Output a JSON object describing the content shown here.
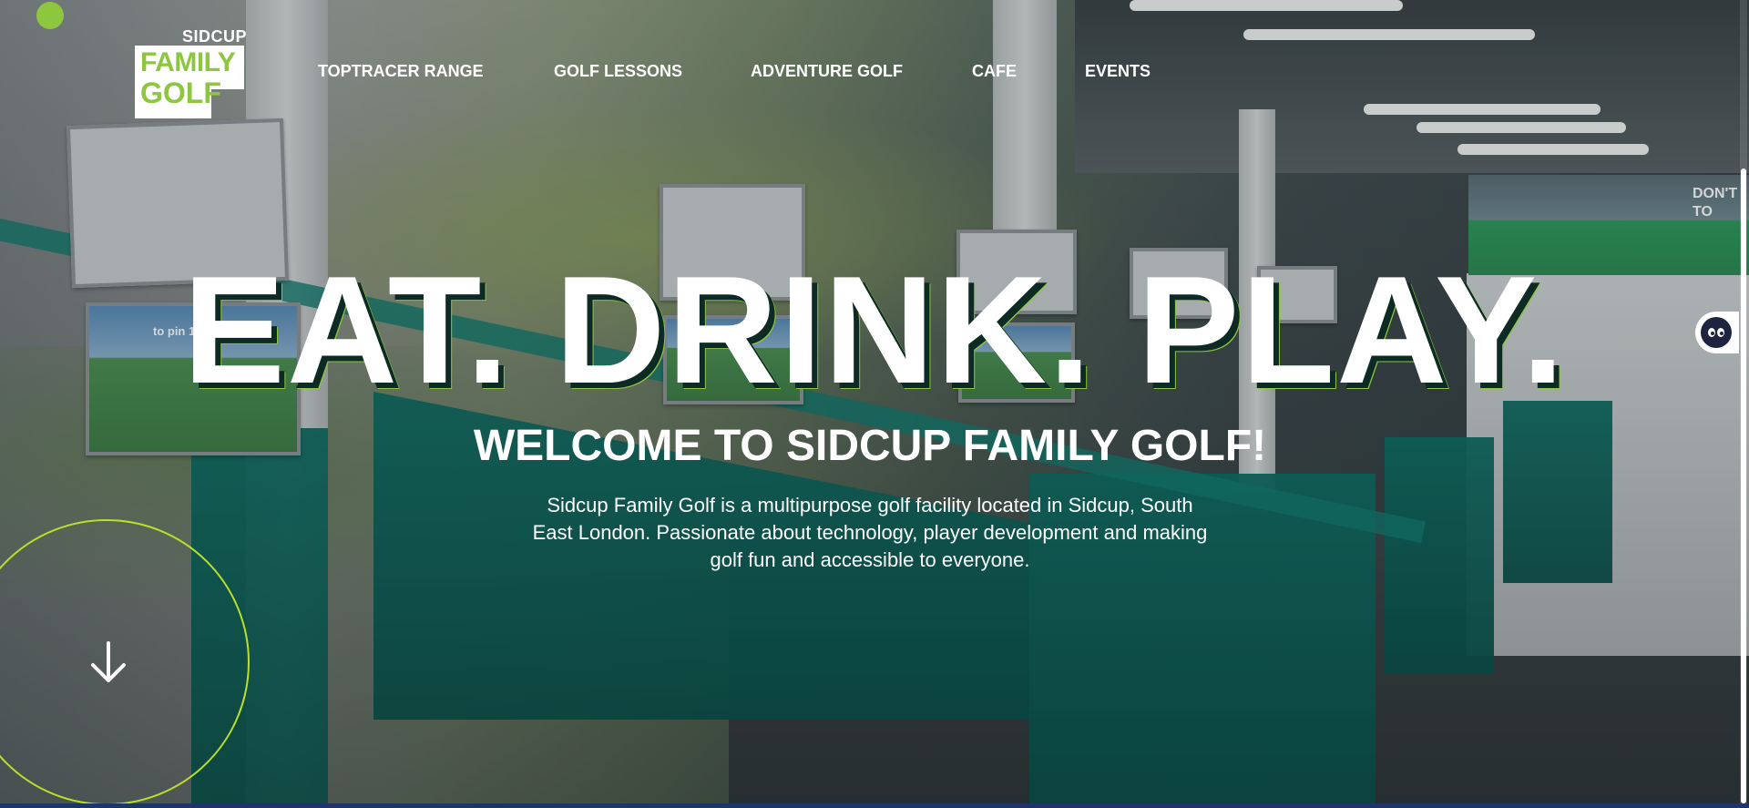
{
  "brand": {
    "logo_top": "SIDCUP",
    "logo_line1": "FAMILY",
    "logo_line2": "GOLF",
    "accent_color": "#8dc63f",
    "outline_color": "#b8e02a"
  },
  "nav": {
    "items": [
      {
        "label": "TOPTRACER RANGE"
      },
      {
        "label": "GOLF LESSONS"
      },
      {
        "label": "ADVENTURE GOLF"
      },
      {
        "label": "CAFE"
      },
      {
        "label": "EVENTS"
      }
    ]
  },
  "hero": {
    "title": "EAT. DRINK. PLAY.",
    "welcome": "WELCOME TO SIDCUP FAMILY GOLF!",
    "description": "Sidcup Family Golf is a multipurpose golf facility located in Sidcup, South East London. Passionate about technology, player development and making golf fun and accessible to everyone.",
    "scroll_icon": "arrow-down-icon",
    "screen_text": "to pin 116",
    "poster_text": "DON'T TO"
  },
  "widgets": {
    "chat_icon": "chat-bot-icon"
  }
}
